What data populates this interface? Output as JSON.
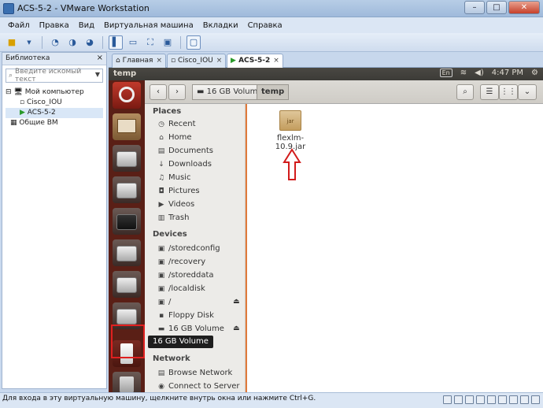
{
  "window": {
    "title": "ACS-5-2 - VMware Workstation"
  },
  "menu": [
    "Файл",
    "Правка",
    "Вид",
    "Виртуальная машина",
    "Вкладки",
    "Справка"
  ],
  "library": {
    "title": "Библиотека",
    "close": "×",
    "search_placeholder": "Введите искомый текст",
    "items": {
      "my_computer": "Мой компьютер",
      "vm1": "Cisco_IOU",
      "vm2": "ACS-5-2",
      "shared": "Общие ВМ"
    }
  },
  "tabs": {
    "home": "Главная",
    "cisco": "Cisco_IOU",
    "acs": "ACS-5-2",
    "close": "×"
  },
  "ubuntu": {
    "window_label": "temp",
    "lang": "En",
    "time": "4:47 PM"
  },
  "file_manager": {
    "crumbs": [
      "16 GB Volume",
      "temp"
    ],
    "places_header": "Places",
    "places": [
      "Recent",
      "Home",
      "Documents",
      "Downloads",
      "Music",
      "Pictures",
      "Videos",
      "Trash"
    ],
    "devices_header": "Devices",
    "devices": [
      "/storedconfig",
      "/recovery",
      "/storeddata",
      "/localdisk",
      "/",
      "Floppy Disk",
      "16 GB Volume"
    ],
    "network_header": "Network",
    "network": [
      "Browse Network",
      "Connect to Server"
    ],
    "file": {
      "name": "flexlm-10.9.jar",
      "badge": "jar"
    }
  },
  "tooltip": "16 GB Volume",
  "status": {
    "text": "Для входа в эту виртуальную машину, щелкните внутрь окна или нажмите Ctrl+G."
  },
  "colors": {
    "accent_orange": "#e07a3a",
    "launcher": "#5a1f16",
    "highlight_red": "#e02020"
  }
}
